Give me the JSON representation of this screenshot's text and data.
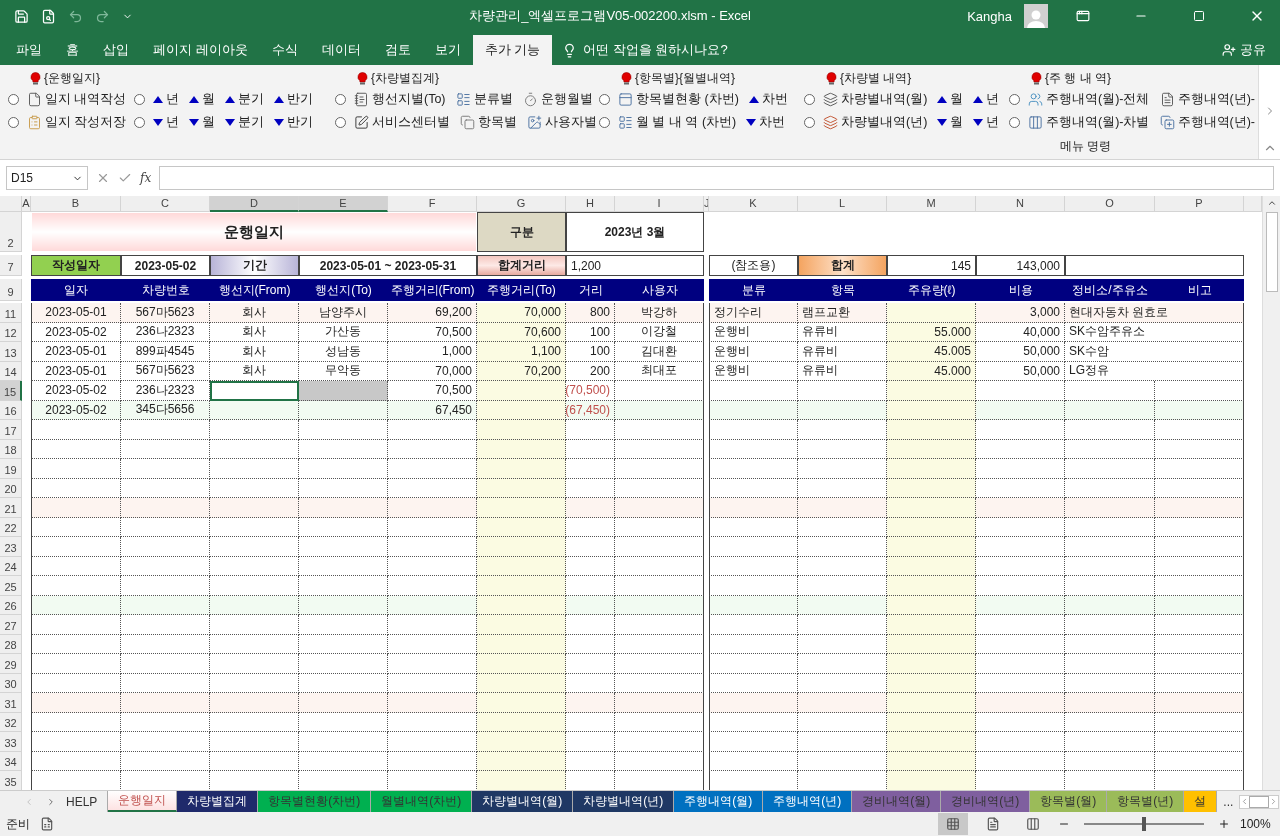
{
  "window": {
    "title": "차량관리_엑셀프로그램V05-002200.xlsm  -  Excel",
    "user": "Kangha"
  },
  "ribbon_tabs": [
    {
      "label": "파일",
      "selected": false
    },
    {
      "label": "홈",
      "selected": false
    },
    {
      "label": "삽입",
      "selected": false
    },
    {
      "label": "페이지 레이아웃",
      "selected": false
    },
    {
      "label": "수식",
      "selected": false
    },
    {
      "label": "데이터",
      "selected": false
    },
    {
      "label": "검토",
      "selected": false
    },
    {
      "label": "보기",
      "selected": false
    },
    {
      "label": "추가 기능",
      "selected": true
    }
  ],
  "tell_me": "어떤 작업을 원하시나요?",
  "share": "공유",
  "ribbon": {
    "group_label": "메뉴 명령",
    "sections": [
      {
        "title": "{운행일지}",
        "rows": [
          {
            "items": [
              {
                "kind": "radio",
                "selected": false
              },
              {
                "kind": "command",
                "label": "일지 내역작성"
              },
              {
                "kind": "radio",
                "selected": false
              },
              {
                "kind": "up",
                "label": "년"
              },
              {
                "kind": "up",
                "label": "월"
              },
              {
                "kind": "up",
                "label": "분기"
              },
              {
                "kind": "up",
                "label": "반기"
              }
            ]
          },
          {
            "items": [
              {
                "kind": "radio",
                "selected": false
              },
              {
                "kind": "command",
                "label": "일지 작성저장"
              },
              {
                "kind": "radio",
                "selected": false
              },
              {
                "kind": "down",
                "label": "년"
              },
              {
                "kind": "down",
                "label": "월"
              },
              {
                "kind": "down",
                "label": "분기"
              },
              {
                "kind": "down",
                "label": "반기"
              }
            ]
          }
        ]
      },
      {
        "title": "{차량별집계}",
        "rows": [
          {
            "items": [
              {
                "kind": "radio",
                "selected": false
              },
              {
                "kind": "command",
                "label": "행선지별(To)"
              },
              {
                "kind": "command",
                "label": "분류별"
              },
              {
                "kind": "command",
                "label": "운행월별"
              }
            ]
          },
          {
            "items": [
              {
                "kind": "radio",
                "selected": false
              },
              {
                "kind": "command",
                "label": "서비스센터별"
              },
              {
                "kind": "command",
                "label": "항목별"
              },
              {
                "kind": "command",
                "label": "사용자별"
              }
            ]
          }
        ]
      },
      {
        "title": "{항목별}{월별내역}",
        "rows": [
          {
            "items": [
              {
                "kind": "radio",
                "selected": false
              },
              {
                "kind": "command",
                "label": "항목별현황 (차번)"
              },
              {
                "kind": "up",
                "label": "차번"
              }
            ]
          },
          {
            "items": [
              {
                "kind": "radio",
                "selected": false
              },
              {
                "kind": "command",
                "label": "월 별 내 역 (차번)"
              },
              {
                "kind": "down",
                "label": "차번"
              }
            ]
          }
        ]
      },
      {
        "title": "{차량별 내역}",
        "rows": [
          {
            "items": [
              {
                "kind": "radio",
                "selected": false
              },
              {
                "kind": "command",
                "label": "차량별내역(월)"
              },
              {
                "kind": "up",
                "label": "월"
              },
              {
                "kind": "up",
                "label": "년"
              }
            ]
          },
          {
            "items": [
              {
                "kind": "radio",
                "selected": false
              },
              {
                "kind": "command",
                "label": "차량별내역(년)"
              },
              {
                "kind": "down",
                "label": "월"
              },
              {
                "kind": "down",
                "label": "년"
              }
            ]
          }
        ]
      },
      {
        "title": "{주 행 내 역}",
        "rows": [
          {
            "items": [
              {
                "kind": "radio",
                "selected": false
              },
              {
                "kind": "command",
                "label": "주행내역(월)-전체"
              },
              {
                "kind": "command",
                "label": "주행내역(년)-"
              }
            ]
          },
          {
            "items": [
              {
                "kind": "radio",
                "selected": false
              },
              {
                "kind": "command",
                "label": "주행내역(월)-차별"
              },
              {
                "kind": "command",
                "label": "주행내역(년)-"
              }
            ]
          }
        ]
      }
    ]
  },
  "formula_bar": {
    "name_box": "D15",
    "function_label": "fx"
  },
  "columns": [
    {
      "letter": "A",
      "selected": false
    },
    {
      "letter": "B",
      "selected": false
    },
    {
      "letter": "C",
      "selected": false
    },
    {
      "letter": "D",
      "selected": true
    },
    {
      "letter": "E",
      "selected": true
    },
    {
      "letter": "F",
      "selected": false
    },
    {
      "letter": "G",
      "selected": false
    },
    {
      "letter": "H",
      "selected": false
    },
    {
      "letter": "I",
      "selected": false
    },
    {
      "letter": "J",
      "selected": false
    },
    {
      "letter": "K",
      "selected": false
    },
    {
      "letter": "L",
      "selected": false
    },
    {
      "letter": "M",
      "selected": false
    },
    {
      "letter": "N",
      "selected": false
    },
    {
      "letter": "O",
      "selected": false
    },
    {
      "letter": "P",
      "selected": false
    }
  ],
  "title_block": {
    "row": "2",
    "title": "운행일지",
    "period_label": "구분",
    "period": "2023년 3월"
  },
  "summary": {
    "row": "7",
    "date_label": "작성일자",
    "date": "2023-05-02",
    "range_label": "기간",
    "range": "2023-05-01  ~ 2023-05-31",
    "distance_label": "합계거리",
    "distance": "1,200",
    "reference": "(참조용)",
    "total_label": "합계",
    "total_fuel": "145",
    "total_cost": "143,000"
  },
  "header_row": "9",
  "log_headers": [
    "일자",
    "차량번호",
    "행선지(From)",
    "행선지(To)",
    "주행거리(From)",
    "주행거리(To)",
    "거리",
    "사용자"
  ],
  "expense_headers": [
    "분류",
    "항목",
    "주유량(ℓ)",
    "비용",
    "정비소/주유소",
    "비고"
  ],
  "rows": [
    {
      "number": "11",
      "selected": false,
      "cells": {
        "B": "2023-05-01",
        "C": "567마5623",
        "D": "회사",
        "E": "남양주시",
        "F": "69,200",
        "G": "70,000",
        "H": "800",
        "I": "박강하",
        "K": "정기수리",
        "L": "램프교환",
        "N": "3,000",
        "O": "현대자동차 원효로"
      }
    },
    {
      "number": "12",
      "selected": false,
      "cells": {
        "B": "2023-05-02",
        "C": "236나2323",
        "D": "회사",
        "E": "가산동",
        "F": "70,500",
        "G": "70,600",
        "H": "100",
        "I": "이강철",
        "K": "운행비",
        "L": "유류비",
        "M": "55.000",
        "N": "40,000",
        "O": "SK수암주유소"
      }
    },
    {
      "number": "13",
      "selected": false,
      "cells": {
        "B": "2023-05-01",
        "C": "899파4545",
        "D": "회사",
        "E": "성남동",
        "F": "1,000",
        "G": "1,100",
        "H": "100",
        "I": "김대환",
        "K": "운행비",
        "L": "유류비",
        "M": "45.005",
        "N": "50,000",
        "O": "SK수암"
      }
    },
    {
      "number": "14",
      "selected": false,
      "cells": {
        "B": "2023-05-01",
        "C": "567마5623",
        "D": "회사",
        "E": "무악동",
        "F": "70,000",
        "G": "70,200",
        "H": "200",
        "I": "최대포",
        "K": "운행비",
        "L": "유류비",
        "M": "45.000",
        "N": "50,000",
        "O": "LG정유"
      }
    },
    {
      "number": "15",
      "selected": true,
      "cells": {
        "B": "2023-05-02",
        "C": "236나2323",
        "F": "70,500",
        "H": {
          "text": "(70,500)",
          "negative": true
        }
      }
    },
    {
      "number": "16",
      "selected": false,
      "cells": {
        "B": "2023-05-02",
        "C": "345다5656",
        "F": "67,450",
        "H": {
          "text": "(67,450)",
          "negative": true
        }
      }
    },
    {
      "number": "17",
      "selected": false
    },
    {
      "number": "18",
      "selected": false
    },
    {
      "number": "19",
      "selected": false
    },
    {
      "number": "20",
      "selected": false
    },
    {
      "number": "21",
      "selected": false
    },
    {
      "number": "22",
      "selected": false
    },
    {
      "number": "23",
      "selected": false
    },
    {
      "number": "24",
      "selected": false
    },
    {
      "number": "25",
      "selected": false
    },
    {
      "number": "26",
      "selected": false
    },
    {
      "number": "27",
      "selected": false
    },
    {
      "number": "28",
      "selected": false
    },
    {
      "number": "29",
      "selected": false
    },
    {
      "number": "30",
      "selected": false
    },
    {
      "number": "31",
      "selected": false
    },
    {
      "number": "32",
      "selected": false
    },
    {
      "number": "33",
      "selected": false
    },
    {
      "number": "34",
      "selected": false
    },
    {
      "number": "35",
      "selected": false
    }
  ],
  "sheet_tabs": [
    {
      "label": "HELP",
      "selected": false
    },
    {
      "label": "운행일지",
      "selected": true
    },
    {
      "label": "차량별집계",
      "selected": false,
      "color": "#1f2a6b"
    },
    {
      "label": "항목별현황(차번)",
      "selected": false,
      "color": "#00b050"
    },
    {
      "label": "월별내역(차번)",
      "selected": false,
      "color": "#00b050"
    },
    {
      "label": "차량별내역(월)",
      "selected": false,
      "color": "#1f3864"
    },
    {
      "label": "차량별내역(년)",
      "selected": false,
      "color": "#1f3864"
    },
    {
      "label": "주행내역(월)",
      "selected": false,
      "color": "#0070c0"
    },
    {
      "label": "주행내역(년)",
      "selected": false,
      "color": "#0070c0"
    },
    {
      "label": "경비내역(월)",
      "selected": false,
      "color": "#7f5f9f"
    },
    {
      "label": "경비내역(년)",
      "selected": false,
      "color": "#7f5f9f"
    },
    {
      "label": "항목별(월)",
      "selected": false,
      "color": "#9bbb59"
    },
    {
      "label": "항목별(년)",
      "selected": false,
      "color": "#9bbb59"
    },
    {
      "label": "설",
      "selected": false,
      "color": "#ffc000"
    }
  ],
  "more_tabs": "...",
  "status": {
    "text": "준비",
    "views": [
      {
        "selected": true
      },
      {
        "selected": false
      },
      {
        "selected": false
      }
    ],
    "zoom": {
      "level": 0.5,
      "reading": "100%"
    }
  }
}
